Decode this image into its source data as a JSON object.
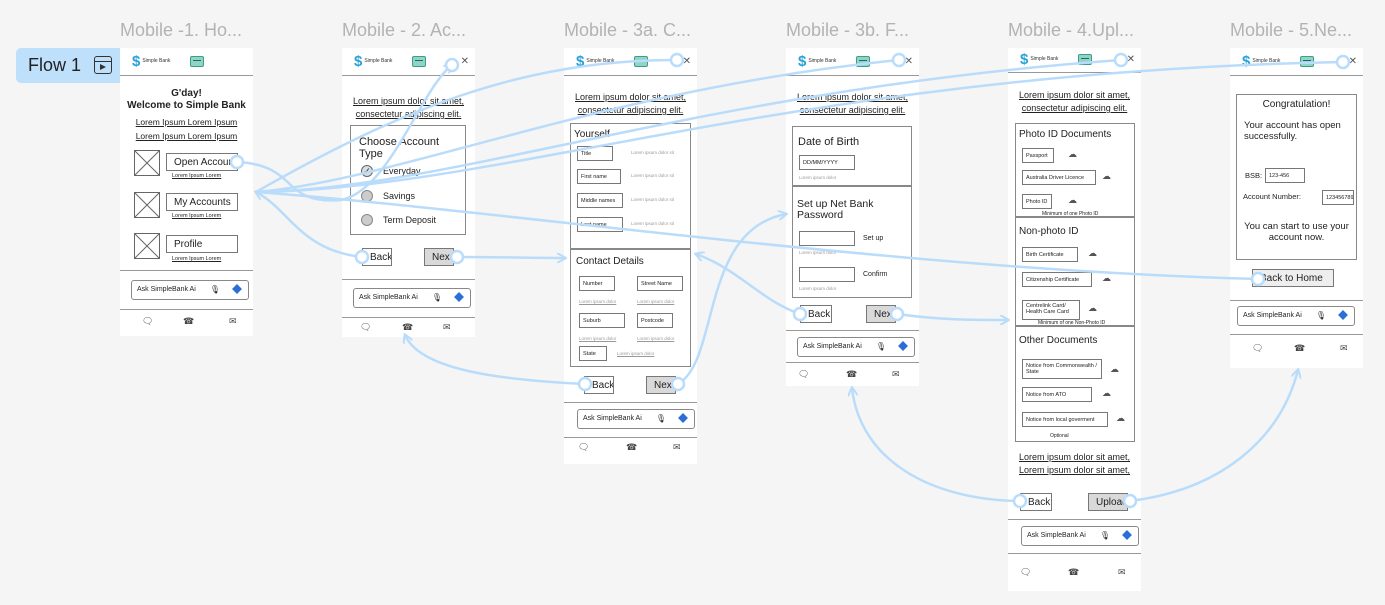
{
  "flow": {
    "label": "Flow 1"
  },
  "frames": {
    "f1": {
      "title": "Mobile -1. Ho..."
    },
    "f2": {
      "title": "Mobile - 2. Ac..."
    },
    "f3": {
      "title": "Mobile - 3a. C..."
    },
    "f4": {
      "title": "Mobile - 3b. F..."
    },
    "f5": {
      "title": "Mobile - 4.Upl..."
    },
    "f6": {
      "title": "Mobile - 5.Ne..."
    }
  },
  "common": {
    "logo_text": "Simple Bank",
    "ask_label": "Ask SimpleBank Ai",
    "close": "✕",
    "chat_glyph": "🗨",
    "phone_glyph": "☎",
    "mail_glyph": "✉",
    "mic_glyph": "🎙",
    "upload_glyph": "☁",
    "lorem_1": "Lorem ipsum dolor sit amet,",
    "lorem_2": "consectetur adipiscing elit.",
    "hint": "Lorem ipsum dolor",
    "hint_long": "Lorem ipsum dolor sit"
  },
  "screen1": {
    "greeting": "G'day!",
    "welcome": "Welcome to Simple Bank",
    "lorem_a": "Lorem Ipsum Lorem Ipsum",
    "lorem_b": "Lorem Ipsum Lorem Ipsum",
    "menu": [
      {
        "label": "Open Accoun",
        "sub": "Lorem Ipsum Lorem"
      },
      {
        "label": "My Accounts",
        "sub": "Lorem Ipsum Lorem"
      },
      {
        "label": "Profile",
        "sub": "Lorem Ipsum Lorem"
      }
    ]
  },
  "screen2": {
    "heading": "Choose Account Type",
    "options": [
      {
        "label": "Everyday",
        "checked": true
      },
      {
        "label": "Savings",
        "checked": false
      },
      {
        "label": "Term Deposit",
        "checked": false
      }
    ],
    "back": "Back",
    "next": "Nex"
  },
  "screen3a": {
    "yourself_title": "Yourself",
    "fields": [
      "Title",
      "First name",
      "Middle names",
      "Last name"
    ],
    "contact_title": "Contact Details",
    "number": "Number",
    "street": "Street Name",
    "suburb": "Suburb",
    "postcode": "Postcode",
    "state": "State",
    "back": "Back",
    "next": "Nex"
  },
  "screen3b": {
    "dob_title": "Date of Birth",
    "dob_placeholder": "DD/MM/YYYY",
    "pw_title": "Set up Net Bank Password",
    "setup": "Set up",
    "confirm": "Confirm",
    "back": "Back",
    "next": "Nex"
  },
  "screen4": {
    "photo_title": "Photo ID Documents",
    "photo_docs": [
      "Passport",
      "Australia Driver Licence",
      "Photo ID"
    ],
    "photo_note": "Minimum of one Photo ID",
    "nonphoto_title": "Non-photo ID",
    "nonphoto_docs": [
      "Birth Certificate",
      "Citizenship Certificate",
      "Centrelink Card/ Health Care Card"
    ],
    "nonphoto_note": "Minimum of one Non-Photo ID",
    "other_title": "Other Documents",
    "other_docs": [
      "Notice from Commonwealth / State",
      "Notice from ATO",
      "Notice from local goverment"
    ],
    "optional": "Optional",
    "back": "Back",
    "upload": "Uploac"
  },
  "screen5": {
    "congrats": "Congratulation!",
    "opened": "Your account has open successfully.",
    "bsb_label": "BSB:",
    "bsb_value": "123-456",
    "acct_label": "Account Number:",
    "acct_value": "123456789",
    "start": "You can start to use your account now.",
    "home": "Back to Home"
  },
  "colors": {
    "connector": "#b9dcfb",
    "flow_badge": "#bfe0fb",
    "accent": "#27a2d9"
  }
}
